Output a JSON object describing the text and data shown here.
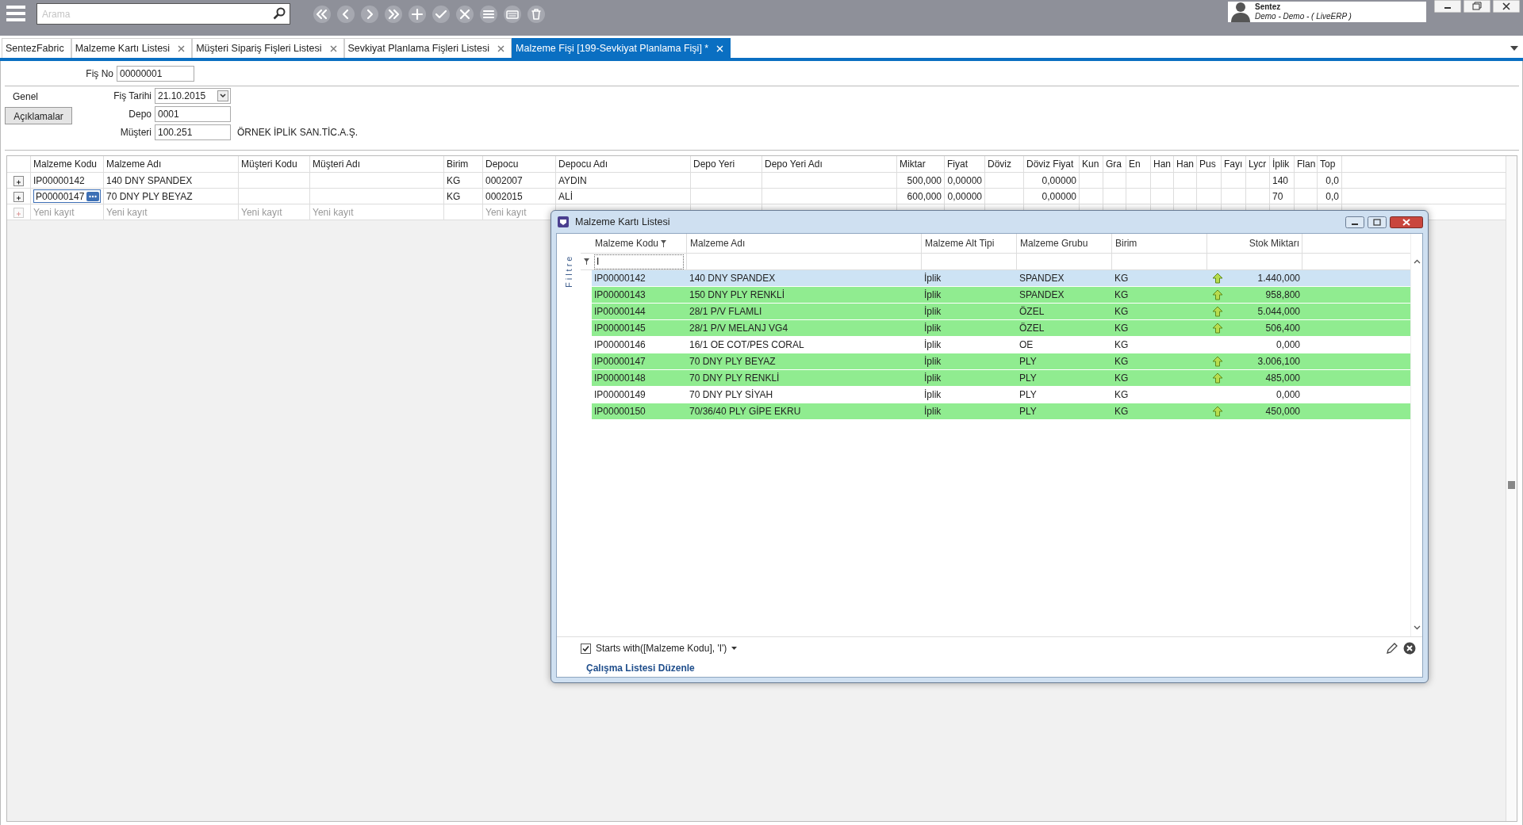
{
  "topbar": {
    "search": {
      "placeholder": "Arama"
    },
    "toolbar": [
      {
        "kind": "first"
      },
      {
        "kind": "prev"
      },
      {
        "kind": "next"
      },
      {
        "kind": "last"
      },
      {
        "kind": "add"
      },
      {
        "kind": "confirm"
      },
      {
        "kind": "cancel"
      },
      {
        "kind": "list"
      },
      {
        "kind": "keyboard"
      },
      {
        "kind": "delete"
      }
    ],
    "user": {
      "name": "Sentez",
      "subtitle": "Demo - Demo - ( LiveERP )"
    }
  },
  "tabs": [
    {
      "label": "SentezFabric",
      "closable": false,
      "selected": false
    },
    {
      "label": "Malzeme Kartı Listesi",
      "closable": true,
      "selected": false
    },
    {
      "label": "Müşteri Sipariş Fişleri Listesi",
      "closable": true,
      "selected": false
    },
    {
      "label": "Sevkiyat Planlama Fişleri Listesi",
      "closable": true,
      "selected": false
    },
    {
      "label": "Malzeme Fişi  [199-Sevkiyat Planlama Fişi] *",
      "closable": true,
      "selected": true
    }
  ],
  "form": {
    "fis_no": {
      "label": "Fiş No",
      "value": "00000001"
    },
    "side_tabs": [
      {
        "label": "Genel",
        "selected": true
      },
      {
        "label": "Açıklamalar",
        "selected": false
      }
    ],
    "fields": [
      {
        "label": "Fiş Tarihi",
        "value": "21.10.2015",
        "kind": "date"
      },
      {
        "label": "Depo",
        "value": "0001",
        "kind": "text"
      },
      {
        "label": "Müşteri",
        "value": "100.251",
        "kind": "text",
        "description": "ÖRNEK İPLİK SAN.TİC.A.Ş."
      }
    ]
  },
  "grid": {
    "columns": [
      {
        "label": "Malzeme Kodu",
        "hint": "Yeni kayıt"
      },
      {
        "label": "Malzeme Adı",
        "hint": "Yeni kayıt"
      },
      {
        "label": "Müşteri Kodu",
        "hint": "Yeni kayıt"
      },
      {
        "label": "Müşteri Adı",
        "hint": "Yeni kayıt"
      },
      {
        "label": "Birim"
      },
      {
        "label": "Depocu",
        "hint": "Yeni kayıt"
      },
      {
        "label": "Depocu Adı"
      },
      {
        "label": "Depo Yeri"
      },
      {
        "label": "Depo Yeri Adı"
      },
      {
        "label": "Miktar"
      },
      {
        "label": "Fiyat"
      },
      {
        "label": "Döviz"
      },
      {
        "label": "Döviz Fiyat"
      },
      {
        "label": "Kun"
      },
      {
        "label": "Gra"
      },
      {
        "label": "En"
      },
      {
        "label": "Han"
      },
      {
        "label": "Han"
      },
      {
        "label": "Pus"
      },
      {
        "label": "Fayı"
      },
      {
        "label": "Lycr"
      },
      {
        "label": "İplik"
      },
      {
        "label": "Flan"
      },
      {
        "label": "Top"
      }
    ],
    "rows": [
      {
        "editing": false,
        "cells": {
          "0": "IP00000142",
          "1": "140 DNY SPANDEX",
          "4": "KG",
          "5": "0002007",
          "6": "AYDIN",
          "9": "500,000",
          "10": "0,00000",
          "12": "0,00000",
          "21": "140",
          "23": "0,0"
        }
      },
      {
        "editing": true,
        "cells": {
          "0": "P00000147",
          "1": "70 DNY PLY BEYAZ",
          "4": "KG",
          "5": "0002015",
          "6": "ALİ",
          "9": "600,000",
          "10": "0,00000",
          "12": "0,00000",
          "21": "70",
          "23": "0,0"
        }
      }
    ]
  },
  "lookup_window": {
    "title": "Malzeme Kartı Listesi",
    "side_label": "Filtre",
    "filter_value": "I",
    "columns": [
      {
        "label": "Malzeme Kodu",
        "filtered": true,
        "kind": "text"
      },
      {
        "label": "Malzeme Adı",
        "filtered": false,
        "kind": "text"
      },
      {
        "label": "Malzeme Alt Tipi",
        "filtered": false,
        "kind": "text"
      },
      {
        "label": "Malzeme Grubu",
        "filtered": false,
        "kind": "text"
      },
      {
        "label": "Birim",
        "filtered": false,
        "kind": "text"
      },
      {
        "label": "Stok Miktarı",
        "filtered": false,
        "kind": "quantity"
      }
    ],
    "rows": [
      {
        "selected": true,
        "in_stock": true,
        "cells": [
          "IP00000142",
          "140 DNY SPANDEX",
          "İplik",
          "SPANDEX",
          "KG",
          "1.440,000"
        ]
      },
      {
        "selected": false,
        "in_stock": true,
        "cells": [
          "IP00000143",
          "150 DNY PLY RENKLİ",
          "İplik",
          "SPANDEX",
          "KG",
          "958,800"
        ]
      },
      {
        "selected": false,
        "in_stock": true,
        "cells": [
          "IP00000144",
          "28/1 P/V FLAMLI",
          "İplik",
          "ÖZEL",
          "KG",
          "5.044,000"
        ]
      },
      {
        "selected": false,
        "in_stock": true,
        "cells": [
          "IP00000145",
          "28/1 P/V MELANJ VG4",
          "İplik",
          "ÖZEL",
          "KG",
          "506,400"
        ]
      },
      {
        "selected": false,
        "in_stock": false,
        "cells": [
          "IP00000146",
          "16/1 OE COT/PES CORAL",
          "İplik",
          "OE",
          "KG",
          "0,000"
        ]
      },
      {
        "selected": false,
        "in_stock": true,
        "cells": [
          "IP00000147",
          "70 DNY PLY BEYAZ",
          "İplik",
          "PLY",
          "KG",
          "3.006,100"
        ]
      },
      {
        "selected": false,
        "in_stock": true,
        "cells": [
          "IP00000148",
          "70 DNY PLY RENKLİ",
          "İplik",
          "PLY",
          "KG",
          "485,000"
        ]
      },
      {
        "selected": false,
        "in_stock": false,
        "cells": [
          "IP00000149",
          "70 DNY PLY SİYAH",
          "İplik",
          "PLY",
          "KG",
          "0,000"
        ]
      },
      {
        "selected": false,
        "in_stock": true,
        "cells": [
          "IP00000150",
          "70/36/40 PLY GİPE EKRU",
          "İplik",
          "PLY",
          "KG",
          "450,000"
        ]
      }
    ],
    "filter_expression": {
      "checked": true,
      "text": "Starts with([Malzeme Kodu], 'I')"
    },
    "link": "Çalışma Listesi Düzenle"
  }
}
